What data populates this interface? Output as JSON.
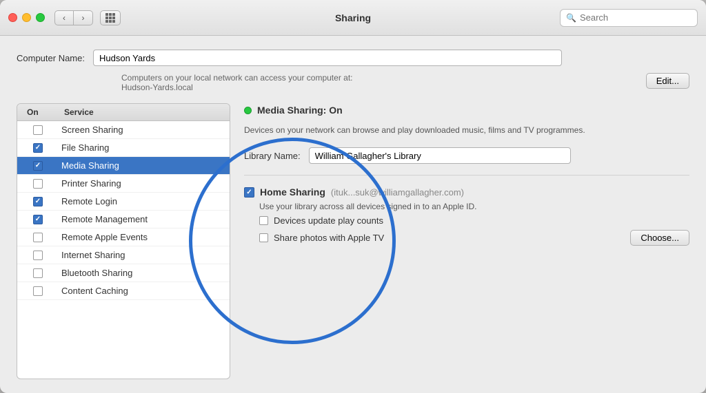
{
  "window": {
    "title": "Sharing"
  },
  "titlebar": {
    "back_label": "‹",
    "forward_label": "›",
    "search_placeholder": "Search"
  },
  "computer_name": {
    "label": "Computer Name:",
    "value": "Hudson Yards",
    "network_text": "Computers on your local network can access your computer at:\nHudson-Yards.local",
    "edit_label": "Edit..."
  },
  "services": {
    "header_on": "On",
    "header_service": "Service",
    "items": [
      {
        "name": "Screen Sharing",
        "checked": false,
        "selected": false
      },
      {
        "name": "File Sharing",
        "checked": true,
        "selected": false
      },
      {
        "name": "Media Sharing",
        "checked": true,
        "selected": true
      },
      {
        "name": "Printer Sharing",
        "checked": false,
        "selected": false
      },
      {
        "name": "Remote Login",
        "checked": true,
        "selected": false
      },
      {
        "name": "Remote Management",
        "checked": true,
        "selected": false
      },
      {
        "name": "Remote Apple Events",
        "checked": false,
        "selected": false
      },
      {
        "name": "Internet Sharing",
        "checked": false,
        "selected": false
      },
      {
        "name": "Bluetooth Sharing",
        "checked": false,
        "selected": false
      },
      {
        "name": "Content Caching",
        "checked": false,
        "selected": false
      }
    ]
  },
  "detail": {
    "status_dot_color": "#28c840",
    "title": "Media Sharing: On",
    "description": "Devices on your network can browse and play downloaded music, films and TV programmes.",
    "library_name_label": "Library Name:",
    "library_name_value": "William Gallagher's Library",
    "home_sharing_title": "Home Sharing",
    "home_sharing_email": "(ituk...suk@williamgallagher.com)",
    "home_sharing_desc": "Use your library across all devices signed in to an Apple ID.",
    "devices_label": "Devices update play counts",
    "photos_label": "Share photos with Apple TV",
    "choose_label": "Choose..."
  }
}
